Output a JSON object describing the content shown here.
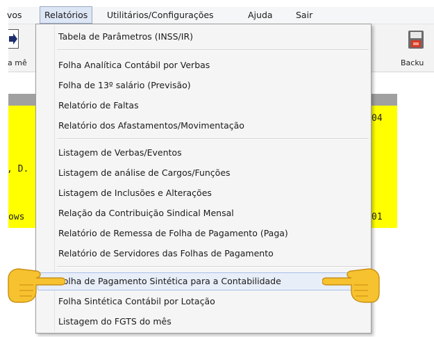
{
  "menubar": {
    "items": [
      "vos",
      "Relatórios",
      "Utilitários/Configurações",
      "Ajuda",
      "Sair"
    ]
  },
  "toolbar": {
    "left_label": "a mê",
    "right_label": "Backu"
  },
  "content": {
    "line1_right": "04",
    "line2_left": ", D.",
    "line3_left": "ows",
    "line3_right": "01"
  },
  "dropdown": {
    "items": [
      "Tabela de Parâmetros (INSS/IR)",
      "Folha Analítica Contábil por Verbas",
      "Folha de 13º salário (Previsão)",
      "Relatório de Faltas",
      "Relatório dos Afastamentos/Movimentação",
      "Listagem de Verbas/Eventos",
      "Listagem de análise de Cargos/Funções",
      "Listagem de Inclusões e Alterações",
      "Relação da Contribuição Sindical Mensal",
      "Relatório de Remessa de Folha de Pagamento (Paga)",
      "Relatório de Servidores das Folhas de Pagamento",
      "Folha de Pagamento Sintética para a Contabilidade",
      "Folha Sintética Contábil por Lotação",
      "Listagem do FGTS do mês"
    ],
    "highlighted_index": 11
  },
  "colors": {
    "highlight": "#e8eef8",
    "content_yellow": "#ffff00",
    "hand": "#f6c22f"
  },
  "icons": [
    "arrow-right-icon",
    "backup-icon",
    "pointing-hand-right-icon",
    "pointing-hand-left-icon"
  ]
}
